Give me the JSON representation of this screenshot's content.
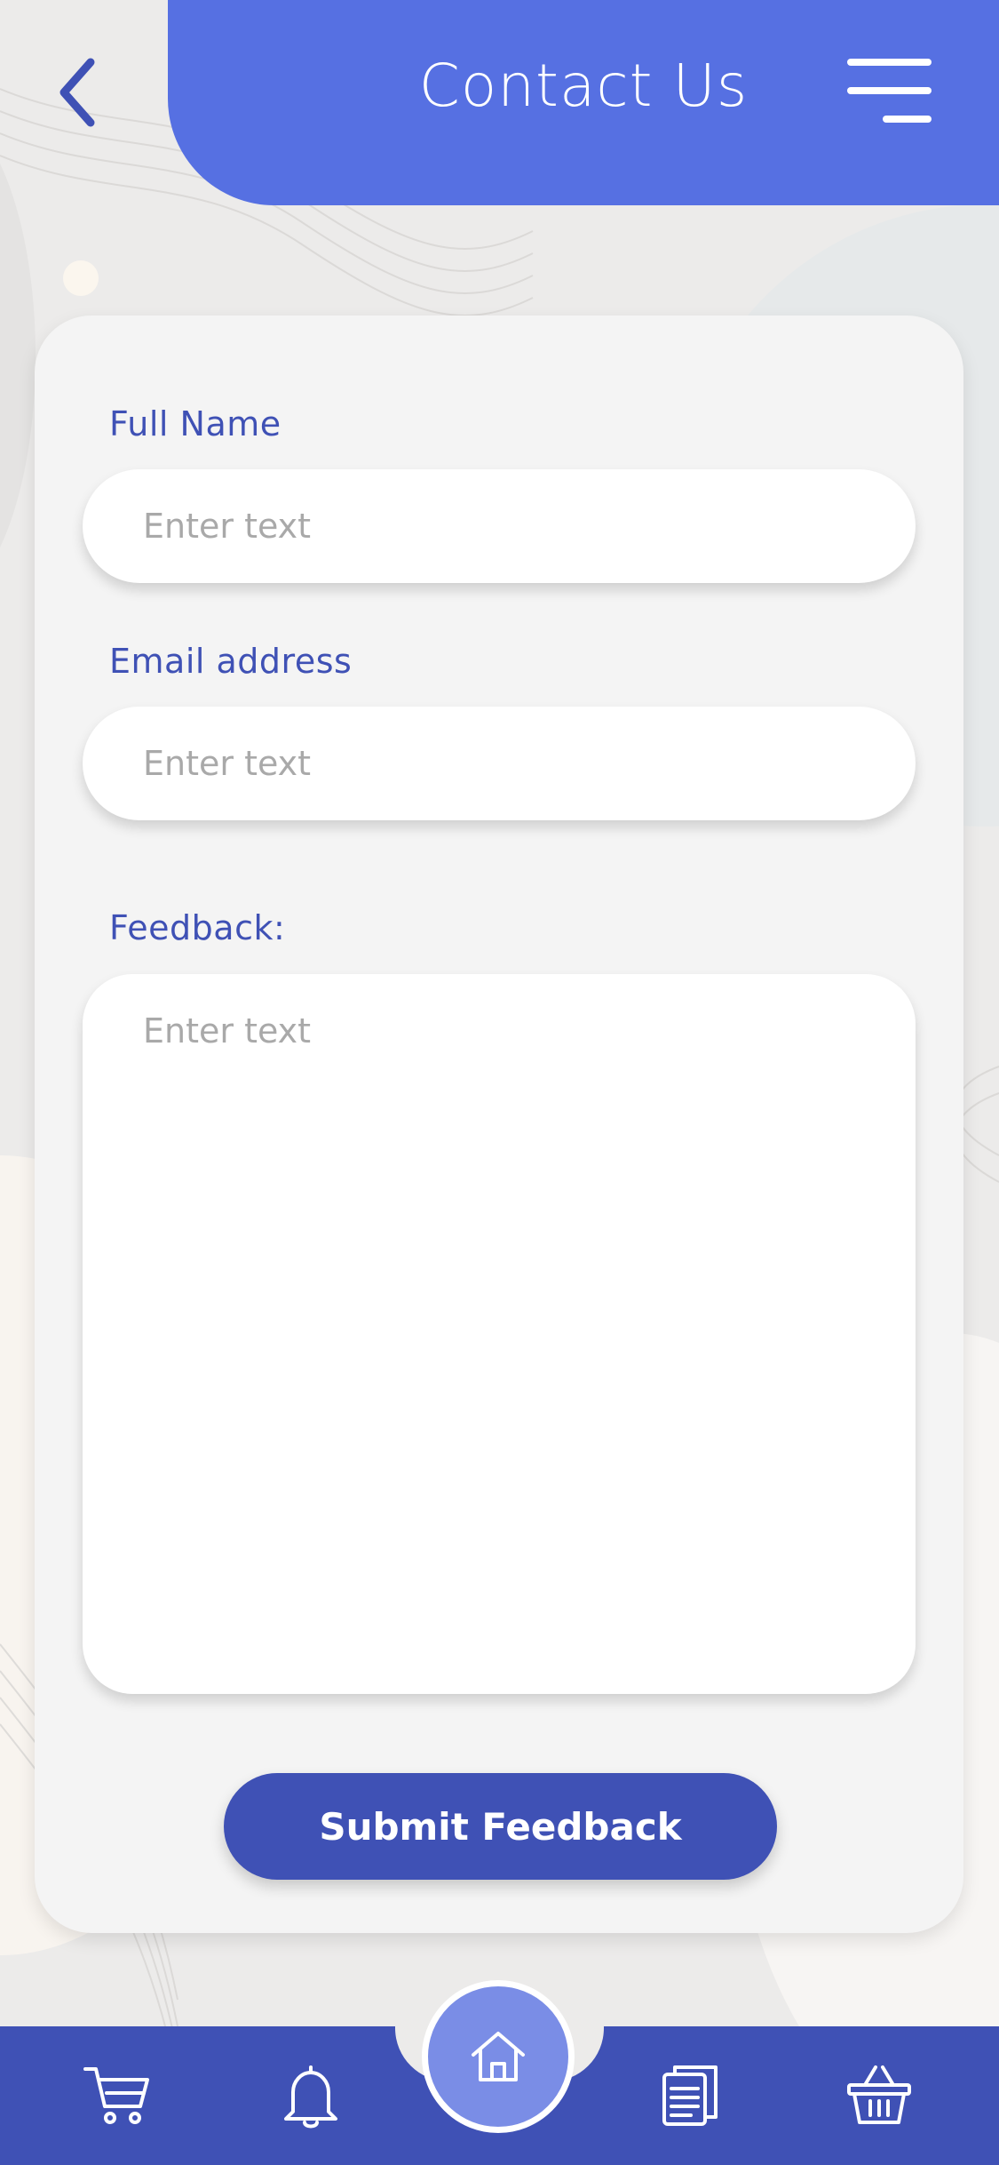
{
  "header": {
    "title": "Contact Us",
    "back_icon": "chevron-left-icon",
    "menu_icon": "hamburger-menu-icon"
  },
  "form": {
    "full_name": {
      "label": "Full Name",
      "placeholder": "Enter text",
      "value": ""
    },
    "email": {
      "label": "Email address",
      "placeholder": "Enter text",
      "value": ""
    },
    "feedback": {
      "label": "Feedback:",
      "placeholder": "Enter text",
      "value": ""
    },
    "submit_label": "Submit Feedback"
  },
  "bottom_nav": {
    "items": [
      {
        "icon": "cart-icon"
      },
      {
        "icon": "bell-icon"
      },
      {
        "icon": "home-icon",
        "active": true
      },
      {
        "icon": "documents-icon"
      },
      {
        "icon": "basket-icon"
      }
    ]
  },
  "colors": {
    "primary": "#3f51b5",
    "header": "#5670e2",
    "home_button": "#7a8de6",
    "card": "#f4f4f4",
    "placeholder": "#a9a9a9"
  }
}
